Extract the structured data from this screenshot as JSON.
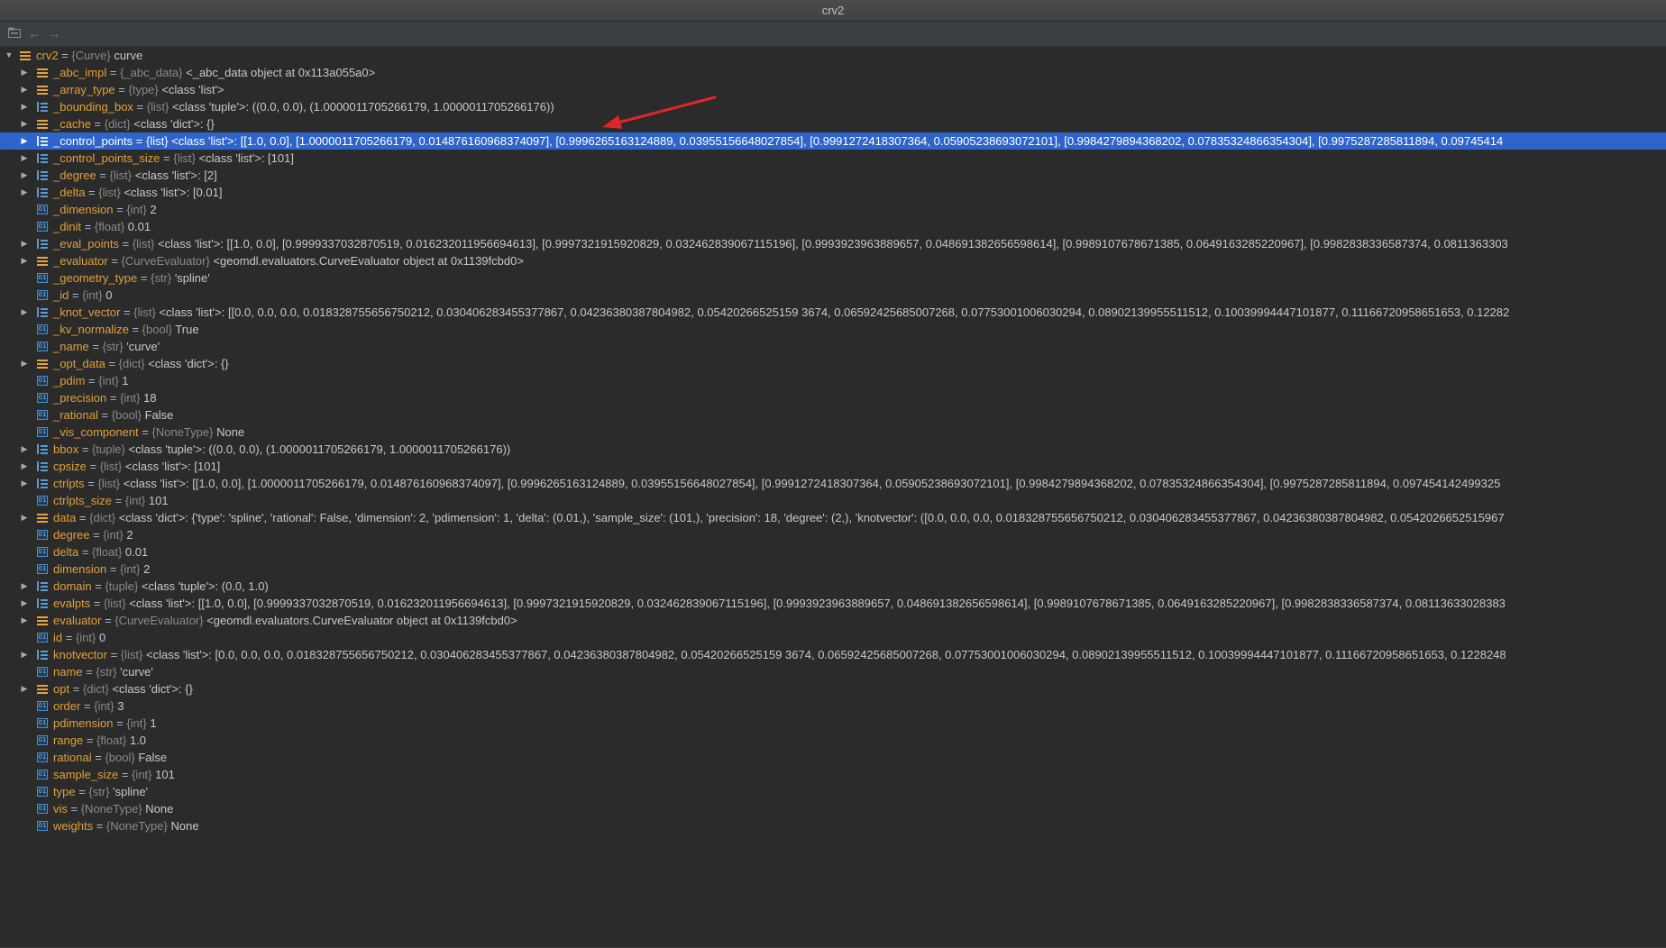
{
  "window": {
    "title": "crv2"
  },
  "toolbar": {
    "icons": [
      "debug-view-icon",
      "back-arrow-icon",
      "forward-arrow-icon"
    ],
    "back_glyph": "←",
    "forward_glyph": "→"
  },
  "colors": {
    "selection": "#2f65ca",
    "variable_name": "#e0a03a",
    "annotation_arrow": "#e0262a"
  },
  "tree": {
    "root": {
      "name": "crv2",
      "type": "{Curve}",
      "value": "curve",
      "expanded": true
    },
    "rows": [
      {
        "name": "_abc_impl",
        "type": "{_abc_data}",
        "value": "<_abc_data object at 0x113a055a0>",
        "icon": "obj",
        "expandable": true
      },
      {
        "name": "_array_type",
        "type": "{type}",
        "value": "<class 'list'>",
        "icon": "obj",
        "expandable": true
      },
      {
        "name": "_bounding_box",
        "type": "{list}",
        "value": "<class 'tuple'>: ((0.0, 0.0), (1.0000011705266179, 1.0000011705266176))",
        "icon": "list",
        "expandable": true
      },
      {
        "name": "_cache",
        "type": "{dict}",
        "value": "<class 'dict'>: {}",
        "icon": "obj",
        "expandable": true
      },
      {
        "name": "_control_points",
        "type": "{list}",
        "value": "<class 'list'>: [[1.0, 0.0], [1.0000011705266179, 0.014876160968374097], [0.9996265163124889, 0.03955156648027854], [0.9991272418307364, 0.05905238693072101], [0.9984279894368202, 0.07835324866354304], [0.9975287285811894, 0.09745414",
        "icon": "list",
        "expandable": true,
        "selected": true
      },
      {
        "name": "_control_points_size",
        "type": "{list}",
        "value": "<class 'list'>: [101]",
        "icon": "list",
        "expandable": true
      },
      {
        "name": "_degree",
        "type": "{list}",
        "value": "<class 'list'>: [2]",
        "icon": "list",
        "expandable": true
      },
      {
        "name": "_delta",
        "type": "{list}",
        "value": "<class 'list'>: [0.01]",
        "icon": "list",
        "expandable": true
      },
      {
        "name": "_dimension",
        "type": "{int}",
        "value": "2",
        "icon": "prim",
        "expandable": false
      },
      {
        "name": "_dinit",
        "type": "{float}",
        "value": "0.01",
        "icon": "prim",
        "expandable": false
      },
      {
        "name": "_eval_points",
        "type": "{list}",
        "value": "<class 'list'>: [[1.0, 0.0], [0.9999337032870519, 0.016232011956694613], [0.9997321915920829, 0.032462839067115196], [0.9993923963889657, 0.048691382656598614], [0.9989107678671385, 0.0649163285220967], [0.9982838336587374, 0.0811363303",
        "icon": "list",
        "expandable": true
      },
      {
        "name": "_evaluator",
        "type": "{CurveEvaluator}",
        "value": "<geomdl.evaluators.CurveEvaluator object at 0x1139fcbd0>",
        "icon": "obj",
        "expandable": true
      },
      {
        "name": "_geometry_type",
        "type": "{str}",
        "value": "'spline'",
        "icon": "prim",
        "expandable": false
      },
      {
        "name": "_id",
        "type": "{int}",
        "value": "0",
        "icon": "prim",
        "expandable": false
      },
      {
        "name": "_knot_vector",
        "type": "{list}",
        "value": "<class 'list'>: [[0.0, 0.0, 0.0, 0.018328755656750212, 0.030406283455377867, 0.04236380387804982, 0.05420266525159 3674, 0.06592425685007268, 0.07753001006030294, 0.08902139955511512, 0.10039994447101877, 0.11166720958651653, 0.12282",
        "icon": "list",
        "expandable": true
      },
      {
        "name": "_kv_normalize",
        "type": "{bool}",
        "value": "True",
        "icon": "prim",
        "expandable": false
      },
      {
        "name": "_name",
        "type": "{str}",
        "value": "'curve'",
        "icon": "prim",
        "expandable": false
      },
      {
        "name": "_opt_data",
        "type": "{dict}",
        "value": "<class 'dict'>: {}",
        "icon": "obj",
        "expandable": true
      },
      {
        "name": "_pdim",
        "type": "{int}",
        "value": "1",
        "icon": "prim",
        "expandable": false
      },
      {
        "name": "_precision",
        "type": "{int}",
        "value": "18",
        "icon": "prim",
        "expandable": false
      },
      {
        "name": "_rational",
        "type": "{bool}",
        "value": "False",
        "icon": "prim",
        "expandable": false
      },
      {
        "name": "_vis_component",
        "type": "{NoneType}",
        "value": "None",
        "icon": "prim",
        "expandable": false
      },
      {
        "name": "bbox",
        "type": "{tuple}",
        "value": "<class 'tuple'>: ((0.0, 0.0), (1.0000011705266179, 1.0000011705266176))",
        "icon": "list",
        "expandable": true
      },
      {
        "name": "cpsize",
        "type": "{list}",
        "value": "<class 'list'>: [101]",
        "icon": "list",
        "expandable": true
      },
      {
        "name": "ctrlpts",
        "type": "{list}",
        "value": "<class 'list'>: [[1.0, 0.0], [1.0000011705266179, 0.014876160968374097], [0.9996265163124889, 0.03955156648027854], [0.9991272418307364, 0.05905238693072101], [0.9984279894368202, 0.07835324866354304], [0.9975287285811894, 0.097454142499325",
        "icon": "list",
        "expandable": true
      },
      {
        "name": "ctrlpts_size",
        "type": "{int}",
        "value": "101",
        "icon": "prim",
        "expandable": false
      },
      {
        "name": "data",
        "type": "{dict}",
        "value": "<class 'dict'>: {'type': 'spline', 'rational': False, 'dimension': 2, 'pdimension': 1, 'delta': (0.01,), 'sample_size': (101,), 'precision': 18, 'degree': (2,), 'knotvector': ([0.0, 0.0, 0.0, 0.018328755656750212, 0.030406283455377867, 0.04236380387804982, 0.0542026652515967",
        "icon": "obj",
        "expandable": true
      },
      {
        "name": "degree",
        "type": "{int}",
        "value": "2",
        "icon": "prim",
        "expandable": false
      },
      {
        "name": "delta",
        "type": "{float}",
        "value": "0.01",
        "icon": "prim",
        "expandable": false
      },
      {
        "name": "dimension",
        "type": "{int}",
        "value": "2",
        "icon": "prim",
        "expandable": false
      },
      {
        "name": "domain",
        "type": "{tuple}",
        "value": "<class 'tuple'>: (0.0, 1.0)",
        "icon": "list",
        "expandable": true
      },
      {
        "name": "evalpts",
        "type": "{list}",
        "value": "<class 'list'>: [[1.0, 0.0], [0.9999337032870519, 0.016232011956694613], [0.9997321915920829, 0.032462839067115196], [0.9993923963889657, 0.048691382656598614], [0.9989107678671385, 0.0649163285220967], [0.9982838336587374, 0.08113633028383",
        "icon": "list",
        "expandable": true
      },
      {
        "name": "evaluator",
        "type": "{CurveEvaluator}",
        "value": "<geomdl.evaluators.CurveEvaluator object at 0x1139fcbd0>",
        "icon": "obj",
        "expandable": true
      },
      {
        "name": "id",
        "type": "{int}",
        "value": "0",
        "icon": "prim",
        "expandable": false
      },
      {
        "name": "knotvector",
        "type": "{list}",
        "value": "<class 'list'>: [0.0, 0.0, 0.0, 0.018328755656750212, 0.030406283455377867, 0.04236380387804982, 0.05420266525159 3674, 0.06592425685007268, 0.07753001006030294, 0.08902139955511512, 0.10039994447101877, 0.11166720958651653, 0.1228248",
        "icon": "list",
        "expandable": true
      },
      {
        "name": "name",
        "type": "{str}",
        "value": "'curve'",
        "icon": "prim",
        "expandable": false
      },
      {
        "name": "opt",
        "type": "{dict}",
        "value": "<class 'dict'>: {}",
        "icon": "obj",
        "expandable": true
      },
      {
        "name": "order",
        "type": "{int}",
        "value": "3",
        "icon": "prim",
        "expandable": false
      },
      {
        "name": "pdimension",
        "type": "{int}",
        "value": "1",
        "icon": "prim",
        "expandable": false
      },
      {
        "name": "range",
        "type": "{float}",
        "value": "1.0",
        "icon": "prim",
        "expandable": false
      },
      {
        "name": "rational",
        "type": "{bool}",
        "value": "False",
        "icon": "prim",
        "expandable": false
      },
      {
        "name": "sample_size",
        "type": "{int}",
        "value": "101",
        "icon": "prim",
        "expandable": false
      },
      {
        "name": "type",
        "type": "{str}",
        "value": "'spline'",
        "icon": "prim",
        "expandable": false
      },
      {
        "name": "vis",
        "type": "{NoneType}",
        "value": "None",
        "icon": "prim",
        "expandable": false
      },
      {
        "name": "weights",
        "type": "{NoneType}",
        "value": "None",
        "icon": "prim",
        "expandable": false
      }
    ]
  }
}
